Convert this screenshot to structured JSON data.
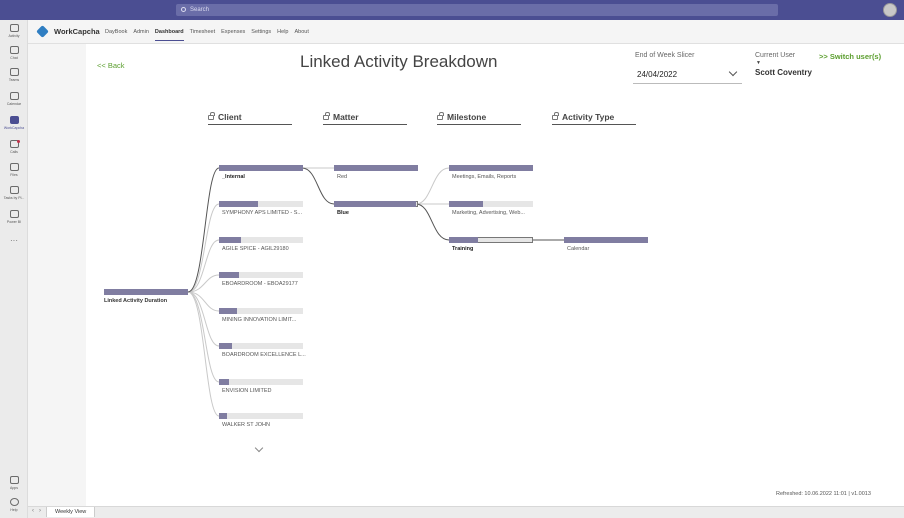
{
  "search": {
    "placeholder": "Search"
  },
  "rail": {
    "items": [
      {
        "label": "Activity",
        "icon": "bell-icon"
      },
      {
        "label": "Chat",
        "icon": "chat-icon"
      },
      {
        "label": "Teams",
        "icon": "teams-icon"
      },
      {
        "label": "Calendar",
        "icon": "calendar-icon"
      },
      {
        "label": "WorkCapcha",
        "icon": "workcapcha-icon"
      },
      {
        "label": "Calls",
        "icon": "phone-icon"
      },
      {
        "label": "Files",
        "icon": "file-icon"
      },
      {
        "label": "Tasks by Pl...",
        "icon": "tasks-icon"
      },
      {
        "label": "Power BI",
        "icon": "powerbi-icon"
      }
    ],
    "more": "···",
    "apps_label": "Apps",
    "help_label": "Help"
  },
  "app": {
    "name": "WorkCapcha",
    "nav": [
      "DayBook",
      "Admin",
      "Dashboard",
      "Timesheet",
      "Expenses",
      "Settings",
      "Help",
      "About"
    ],
    "active_nav": "Dashboard"
  },
  "page": {
    "back": "<< Back",
    "title": "Linked Activity Breakdown",
    "slicer_label": "End of Week Slicer",
    "slicer_value": "24/04/2022",
    "current_user_label": "Current User",
    "current_user_name": "Scott Coventry",
    "switch_user": ">> Switch user(s)",
    "refreshed": "Refreshed: 10.06.2022 11:01 | v1.0013"
  },
  "tree": {
    "root": {
      "label": "Linked Activity Duration",
      "fraction": 1.0
    },
    "levels": [
      "Client",
      "Matter",
      "Milestone",
      "Activity Type"
    ],
    "client": [
      {
        "label": "_Internal",
        "fraction": 1.0,
        "selected": true
      },
      {
        "label": "SYMPHONY APS LIMITED - S...",
        "fraction": 0.46
      },
      {
        "label": "AGILE SPICE - AGIL29180",
        "fraction": 0.26
      },
      {
        "label": "EBOARDROOM - EBOA29177",
        "fraction": 0.24
      },
      {
        "label": "MINING INNOVATION LIMIT...",
        "fraction": 0.21
      },
      {
        "label": "BOARDROOM EXCELLENCE L...",
        "fraction": 0.15
      },
      {
        "label": "ENVISION LIMITED",
        "fraction": 0.12
      },
      {
        "label": "WALKER ST JOHN",
        "fraction": 0.09
      }
    ],
    "matter": [
      {
        "label": "Red",
        "fraction": 1.0
      },
      {
        "label": "Blue",
        "fraction": 0.98,
        "selected": true
      }
    ],
    "milestone": [
      {
        "label": "Meetings, Emails, Reports",
        "fraction": 1.0
      },
      {
        "label": "Marketing, Advertising, Web...",
        "fraction": 0.41
      },
      {
        "label": "Training",
        "fraction": 0.34,
        "selected": true
      }
    ],
    "activity_type": [
      {
        "label": "Calendar",
        "fraction": 1.0
      }
    ]
  },
  "tabs": {
    "active": "Weekly View"
  },
  "colors": {
    "accent": "#4b4e92",
    "bar": "#807da1",
    "link": "#5b9e2e"
  }
}
